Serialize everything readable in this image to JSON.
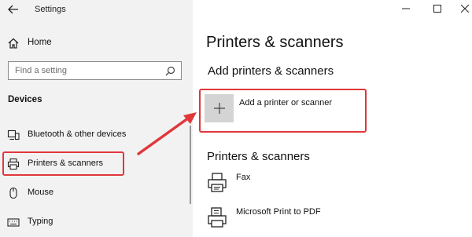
{
  "window": {
    "title": "Settings",
    "controls": {
      "minimize": "minimize-icon",
      "maximize": "maximize-icon",
      "close": "close-icon"
    }
  },
  "sidebar": {
    "home_label": "Home",
    "search": {
      "placeholder": "Find a setting"
    },
    "section_title": "Devices",
    "items": [
      {
        "label": "Bluetooth & other devices",
        "icon": "bluetooth-devices-icon"
      },
      {
        "label": "Printers & scanners",
        "icon": "printer-icon",
        "selected": true
      },
      {
        "label": "Mouse",
        "icon": "mouse-icon"
      },
      {
        "label": "Typing",
        "icon": "keyboard-icon"
      }
    ]
  },
  "main": {
    "title": "Printers & scanners",
    "add_section_title": "Add printers & scanners",
    "add_button_label": "Add a printer or scanner",
    "list_section_title": "Printers & scanners",
    "printers": [
      {
        "name": "Fax",
        "icon": "fax-icon"
      },
      {
        "name": "Microsoft Print to PDF",
        "icon": "printer-icon"
      }
    ]
  },
  "colors": {
    "highlight": "#e0373b",
    "sidebar_bg": "#f2f2f2",
    "add_button_bg": "#d4d4d4"
  }
}
